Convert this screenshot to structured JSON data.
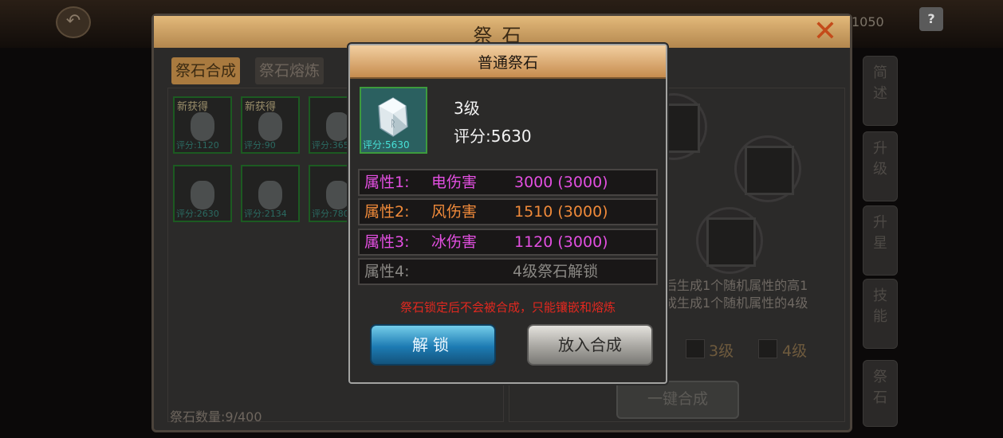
{
  "background": {
    "back_icon": "back-arrow-icon",
    "top_count": "1050",
    "help_label": "?"
  },
  "main_panel": {
    "title": "祭石",
    "close_icon": "close-x-icon",
    "tabs": [
      {
        "label": "祭石合成",
        "active": true
      },
      {
        "label": "祭石熔炼",
        "active": false
      }
    ],
    "stones": [
      {
        "new_label": "新获得",
        "score": "评分:1120"
      },
      {
        "new_label": "新获得",
        "score": "评分:90"
      },
      {
        "new_label": "",
        "score": "评分:365"
      },
      {
        "new_label": "",
        "score": "评分:2630"
      },
      {
        "new_label": "",
        "score": "评分:2134"
      },
      {
        "new_label": "",
        "score": "评分:780"
      }
    ],
    "stone_count": "祭石数量:9/400",
    "desc_line1": "后生成1个随机属性的高1",
    "desc_line2": "成生成1个随机属性的4级",
    "level_options": [
      "3级",
      "4级"
    ],
    "onekey_button": "一键合成",
    "side_buttons": [
      "简述",
      "升级",
      "升星",
      "技能",
      "祭石"
    ]
  },
  "dialog": {
    "title": "普通祭石",
    "item": {
      "score_badge": "评分:5630",
      "level": "3级",
      "rating": "评分:5630",
      "icon": "crystal-stone-icon"
    },
    "attributes": [
      {
        "label": "属性1:",
        "name": "电伤害",
        "value": "3000 (3000)",
        "color": "#e34fe1"
      },
      {
        "label": "属性2:",
        "name": "风伤害",
        "value": "1510 (3000)",
        "color": "#f08a3a"
      },
      {
        "label": "属性3:",
        "name": "冰伤害",
        "value": "1120 (3000)",
        "color": "#e34fe1"
      },
      {
        "label": "属性4:",
        "name": "",
        "value": "4级祭石解锁",
        "color": "#8a8884"
      }
    ],
    "lock_note": "祭石锁定后不会被合成，只能镶嵌和熔炼",
    "unlock_button": "解锁",
    "put_button": "放入合成"
  }
}
